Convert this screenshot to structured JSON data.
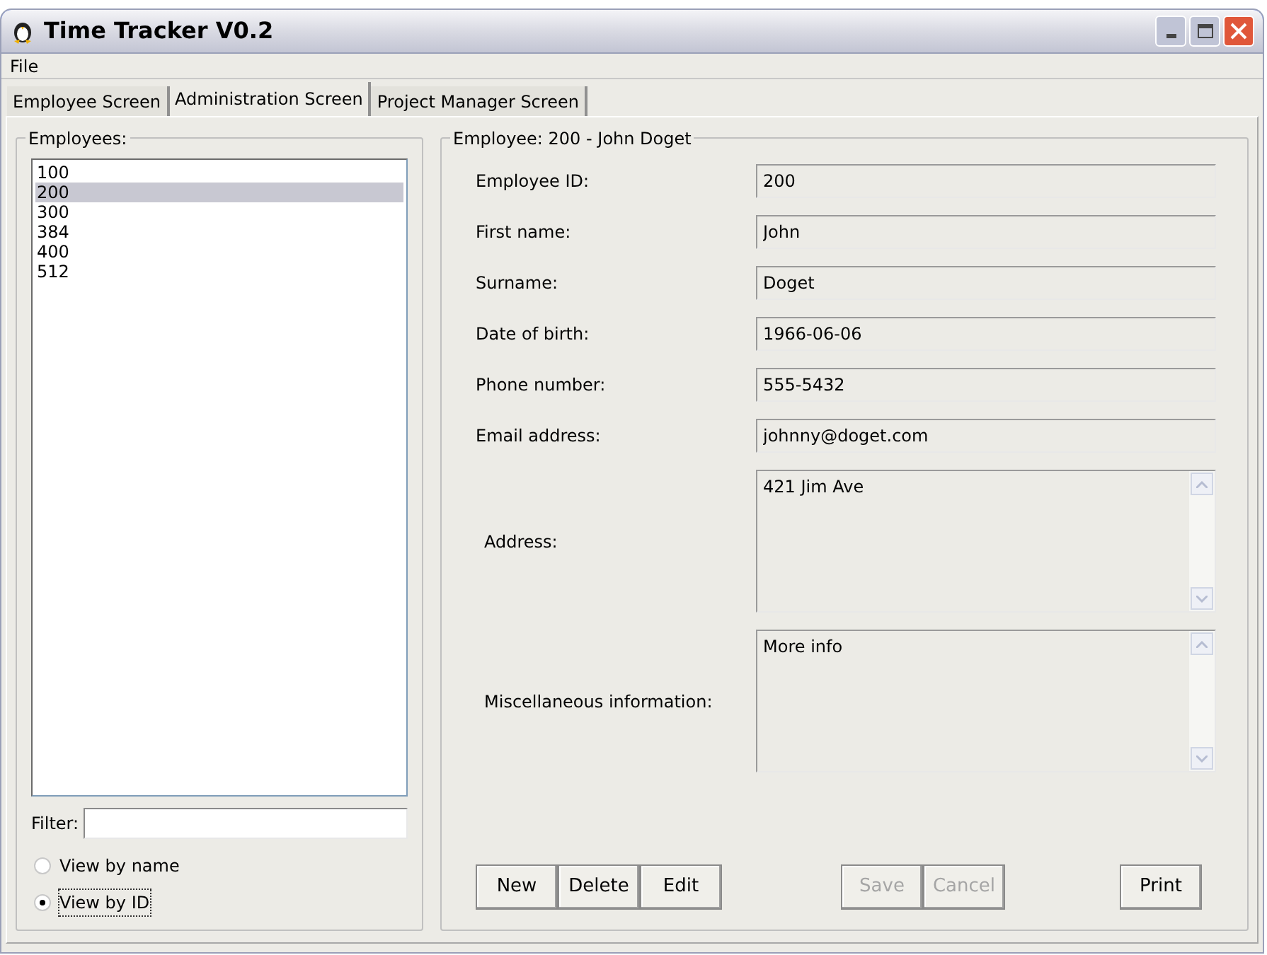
{
  "window": {
    "title": "Time Tracker V0.2"
  },
  "menu": [
    "File"
  ],
  "tabs": [
    {
      "label": "Employee Screen",
      "selected": false
    },
    {
      "label": "Administration Screen",
      "selected": true
    },
    {
      "label": "Project Manager Screen",
      "selected": false
    }
  ],
  "employees_panel": {
    "title": "Employees:",
    "items": [
      {
        "label": "100",
        "selected": false
      },
      {
        "label": "200",
        "selected": true
      },
      {
        "label": "300",
        "selected": false
      },
      {
        "label": "384",
        "selected": false
      },
      {
        "label": "400",
        "selected": false
      },
      {
        "label": "512",
        "selected": false
      }
    ],
    "filter_label": "Filter:",
    "view_options": [
      {
        "label": "View by name",
        "selected": false
      },
      {
        "label": "View by ID",
        "selected": true
      }
    ]
  },
  "details_panel": {
    "title": "Employee: 200 - John Doget",
    "fields": [
      {
        "label": "Employee ID:",
        "value": "200",
        "kind": "line"
      },
      {
        "label": "First name:",
        "value": "John",
        "kind": "line"
      },
      {
        "label": "Surname:",
        "value": "Doget",
        "kind": "line"
      },
      {
        "label": "Date of birth:",
        "value": "1966-06-06",
        "kind": "line"
      },
      {
        "label": "Phone number:",
        "value": "555-5432",
        "kind": "line"
      },
      {
        "label": "Email address:",
        "value": "johnny@doget.com",
        "kind": "line"
      },
      {
        "label": "Address:",
        "value": "421 Jim Ave",
        "kind": "multiline"
      },
      {
        "label": "Miscellaneous information:",
        "value": "More info",
        "kind": "multiline"
      }
    ],
    "button_groups": [
      [
        {
          "label": "New",
          "disabled": false
        },
        {
          "label": "Delete",
          "disabled": false
        },
        {
          "label": "Edit",
          "disabled": false
        }
      ],
      [
        {
          "label": "Save",
          "disabled": true
        },
        {
          "label": "Cancel",
          "disabled": true
        }
      ],
      [
        {
          "label": "Print",
          "disabled": false
        }
      ]
    ]
  }
}
